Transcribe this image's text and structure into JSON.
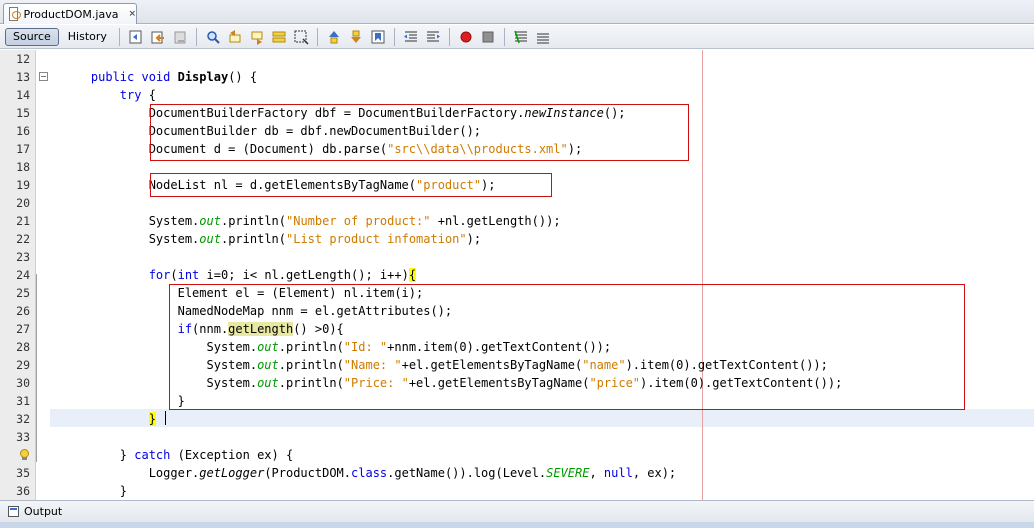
{
  "tab": {
    "title": "ProductDOM.java",
    "close_glyph": "×"
  },
  "toolbar": {
    "source_label": "Source",
    "history_label": "History",
    "icons": [
      "last-edit-icon",
      "back-icon",
      "forward-icon",
      "find-selection-icon",
      "find-previous-icon",
      "find-next-icon",
      "toggle-highlight-icon",
      "toggle-rect-selection-icon",
      "previous-bookmark-icon",
      "next-bookmark-icon",
      "toggle-bookmark-icon",
      "shift-left-icon",
      "shift-right-icon",
      "start-macro-icon",
      "stop-macro-icon",
      "comment-icon",
      "uncomment-icon"
    ]
  },
  "output": {
    "label": "Output"
  },
  "colors": {
    "keyword": "#0000e6",
    "string": "#ce7b00",
    "field": "#009900",
    "highlight_box": "#d01010",
    "brace_highlight": "#ffff00"
  },
  "lines": [
    {
      "num": "12",
      "text": ""
    },
    {
      "num": "13",
      "text": "    public void Display() {"
    },
    {
      "num": "14",
      "text": "        try {"
    },
    {
      "num": "15",
      "text": "            DocumentBuilderFactory dbf = DocumentBuilderFactory.newInstance();"
    },
    {
      "num": "16",
      "text": "            DocumentBuilder db = dbf.newDocumentBuilder();"
    },
    {
      "num": "17",
      "text": "            Document d = (Document) db.parse(\"src\\\\data\\\\products.xml\");"
    },
    {
      "num": "18",
      "text": ""
    },
    {
      "num": "19",
      "text": "            NodeList nl = d.getElementsByTagName(\"product\");"
    },
    {
      "num": "20",
      "text": ""
    },
    {
      "num": "21",
      "text": "            System.out.println(\"Number of product:\" +nl.getLength());"
    },
    {
      "num": "22",
      "text": "            System.out.println(\"List product infomation\");"
    },
    {
      "num": "23",
      "text": ""
    },
    {
      "num": "24",
      "text": "            for(int i=0; i< nl.getLength(); i++){"
    },
    {
      "num": "25",
      "text": "                Element el = (Element) nl.item(i);"
    },
    {
      "num": "26",
      "text": "                NamedNodeMap nnm = el.getAttributes();"
    },
    {
      "num": "27",
      "text": "                if(nnm.getLength() >0){"
    },
    {
      "num": "28",
      "text": "                    System.out.println(\"Id: \"+nnm.item(0).getTextContent());"
    },
    {
      "num": "29",
      "text": "                    System.out.println(\"Name: \"+el.getElementsByTagName(\"name\").item(0).getTextContent());"
    },
    {
      "num": "30",
      "text": "                    System.out.println(\"Price: \"+el.getElementsByTagName(\"price\").item(0).getTextContent());"
    },
    {
      "num": "31",
      "text": "                }"
    },
    {
      "num": "32",
      "text": "            }"
    },
    {
      "num": "33",
      "text": ""
    },
    {
      "num": "34",
      "text": "        } catch (Exception ex) {"
    },
    {
      "num": "35",
      "text": "            Logger.getLogger(ProductDOM.class.getName()).log(Level.SEVERE, null, ex);"
    },
    {
      "num": "36",
      "text": "        }"
    }
  ]
}
